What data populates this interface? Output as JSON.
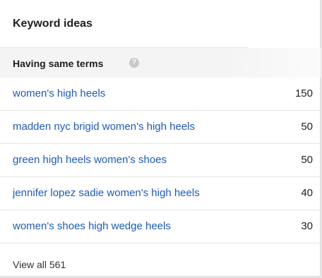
{
  "panel": {
    "title": "Keyword ideas",
    "section_title": "Having same terms",
    "help_icon": "help-circle-icon",
    "rows": [
      {
        "keyword": "women's high heels",
        "count": "150"
      },
      {
        "keyword": "madden nyc brigid women's high heels",
        "count": "50"
      },
      {
        "keyword": "green high heels women's shoes",
        "count": "50"
      },
      {
        "keyword": "jennifer lopez sadie women's high heels",
        "count": "40"
      },
      {
        "keyword": "women's shoes high wedge heels",
        "count": "30"
      }
    ],
    "view_all": "View all 561"
  },
  "colors": {
    "link": "#1f5bb5",
    "text": "#1f1f1f",
    "section_bg": "#f4f4f4"
  }
}
